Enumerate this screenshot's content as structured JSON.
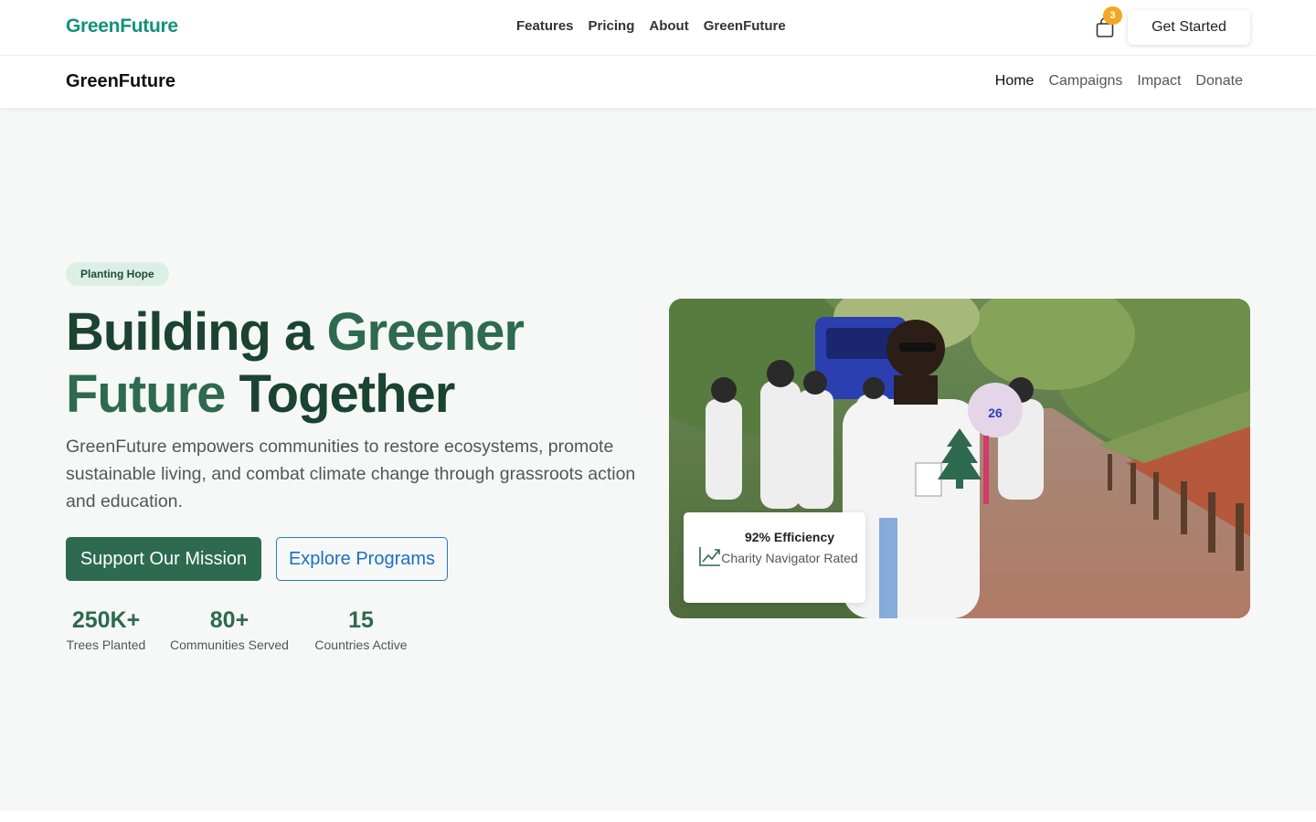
{
  "topbar": {
    "brand": "GreenFuture",
    "links": [
      "Features",
      "Pricing",
      "About",
      "GreenFuture"
    ],
    "cart_count": "3",
    "cta_label": "Get Started"
  },
  "subnav": {
    "brand": "GreenFuture",
    "links": [
      "Home",
      "Campaigns",
      "Impact",
      "Donate"
    ],
    "active": "Home"
  },
  "hero": {
    "badge": "Planting Hope",
    "headline_part1": "Building a ",
    "headline_highlight": "Greener Future",
    "headline_part2": " Together",
    "lead": "GreenFuture empowers communities to restore ecosystems, promote sustainable living, and combat climate change through grassroots action and education.",
    "primary_cta": "Support Our Mission",
    "secondary_cta": "Explore Programs",
    "stats": [
      {
        "value": "250K+",
        "label": "Trees Planted"
      },
      {
        "value": "80+",
        "label": "Communities Served"
      },
      {
        "value": "15",
        "label": "Countries Active"
      }
    ],
    "card": {
      "title": "92% Efficiency",
      "subtitle": "Charity Navigator Rated",
      "icon": "trend-chart-icon"
    }
  },
  "colors": {
    "brand_teal": "#11927a",
    "primary_green": "#2d6a4f",
    "dark_green": "#1b4332",
    "badge_bg": "#dcefe6",
    "link_blue": "#1a6fc4",
    "cart_badge": "#f5a623"
  }
}
